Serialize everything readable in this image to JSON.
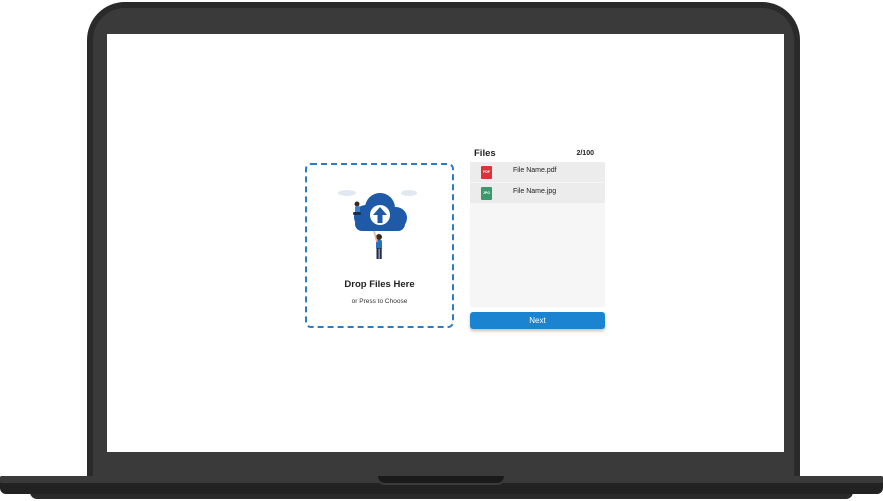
{
  "dropzone": {
    "title": "Drop Files Here",
    "subtitle": "or Press to Choose",
    "illustration": "cloud-upload-person-icon"
  },
  "files": {
    "title": "Files",
    "count": "2/100",
    "items": [
      {
        "name": "File Name.pdf",
        "type_label": "PDF",
        "icon": "pdf-file-icon",
        "color": "#d9343a"
      },
      {
        "name": "File Name.jpg",
        "type_label": "JPG",
        "icon": "jpg-file-icon",
        "color": "#3b9a6b"
      }
    ]
  },
  "actions": {
    "next_label": "Next"
  },
  "colors": {
    "accent": "#1b84d0",
    "dashed_border": "#2f7bc0",
    "list_bg": "#f6f6f6",
    "device_frame": "#2a2a2a"
  }
}
